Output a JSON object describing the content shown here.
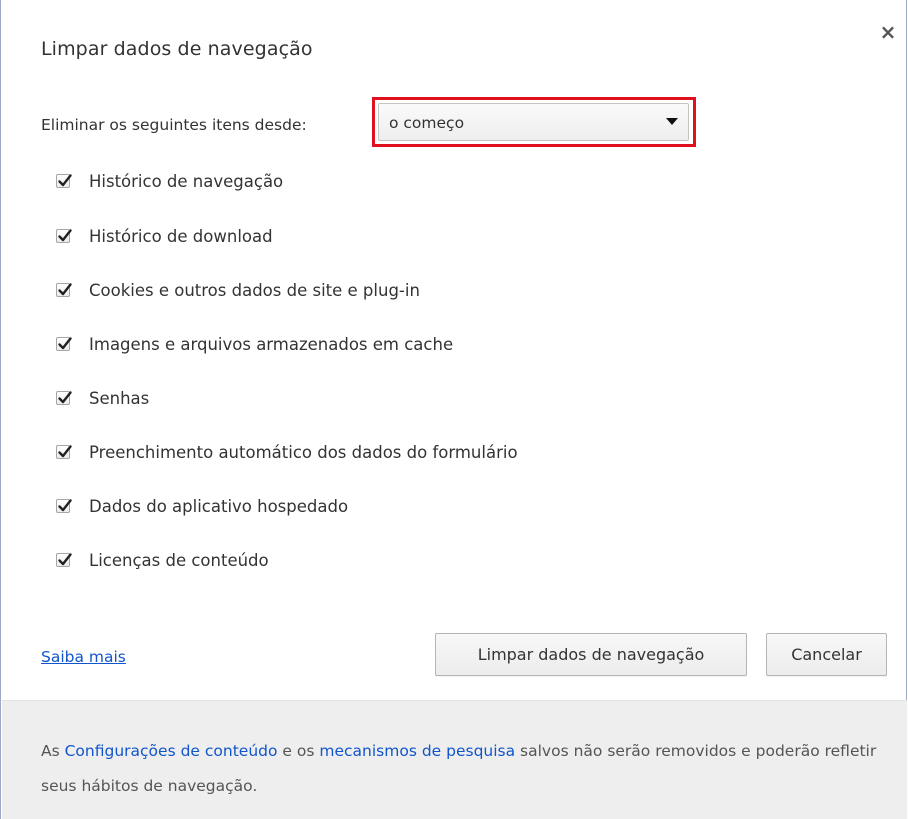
{
  "dialog": {
    "title": "Limpar dados de navegação",
    "close_label": "×"
  },
  "range": {
    "label": "Eliminar os seguintes itens desde:",
    "selected": "o começo",
    "highlight_color": "#e1101e"
  },
  "options": [
    {
      "label": "Histórico de navegação",
      "checked": true
    },
    {
      "label": "Histórico de download",
      "checked": true
    },
    {
      "label": "Cookies e outros dados de site e plug-in",
      "checked": true
    },
    {
      "label": "Imagens e arquivos armazenados em cache",
      "checked": true
    },
    {
      "label": "Senhas",
      "checked": true
    },
    {
      "label": "Preenchimento automático dos dados do formulário",
      "checked": true
    },
    {
      "label": "Dados do aplicativo hospedado",
      "checked": true
    },
    {
      "label": "Licenças de conteúdo",
      "checked": true
    }
  ],
  "actions": {
    "learn_more": "Saiba mais",
    "clear_button": "Limpar dados de navegação",
    "cancel_button": "Cancelar"
  },
  "footer": {
    "text_before": "As ",
    "link_content_settings": "Configurações de conteúdo",
    "text_middle": " e os ",
    "link_search_engines": "mecanismos de pesquisa",
    "text_after": " salvos não serão removidos e poderão refletir seus hábitos de navegação.",
    "link_color": "#1155cc"
  }
}
